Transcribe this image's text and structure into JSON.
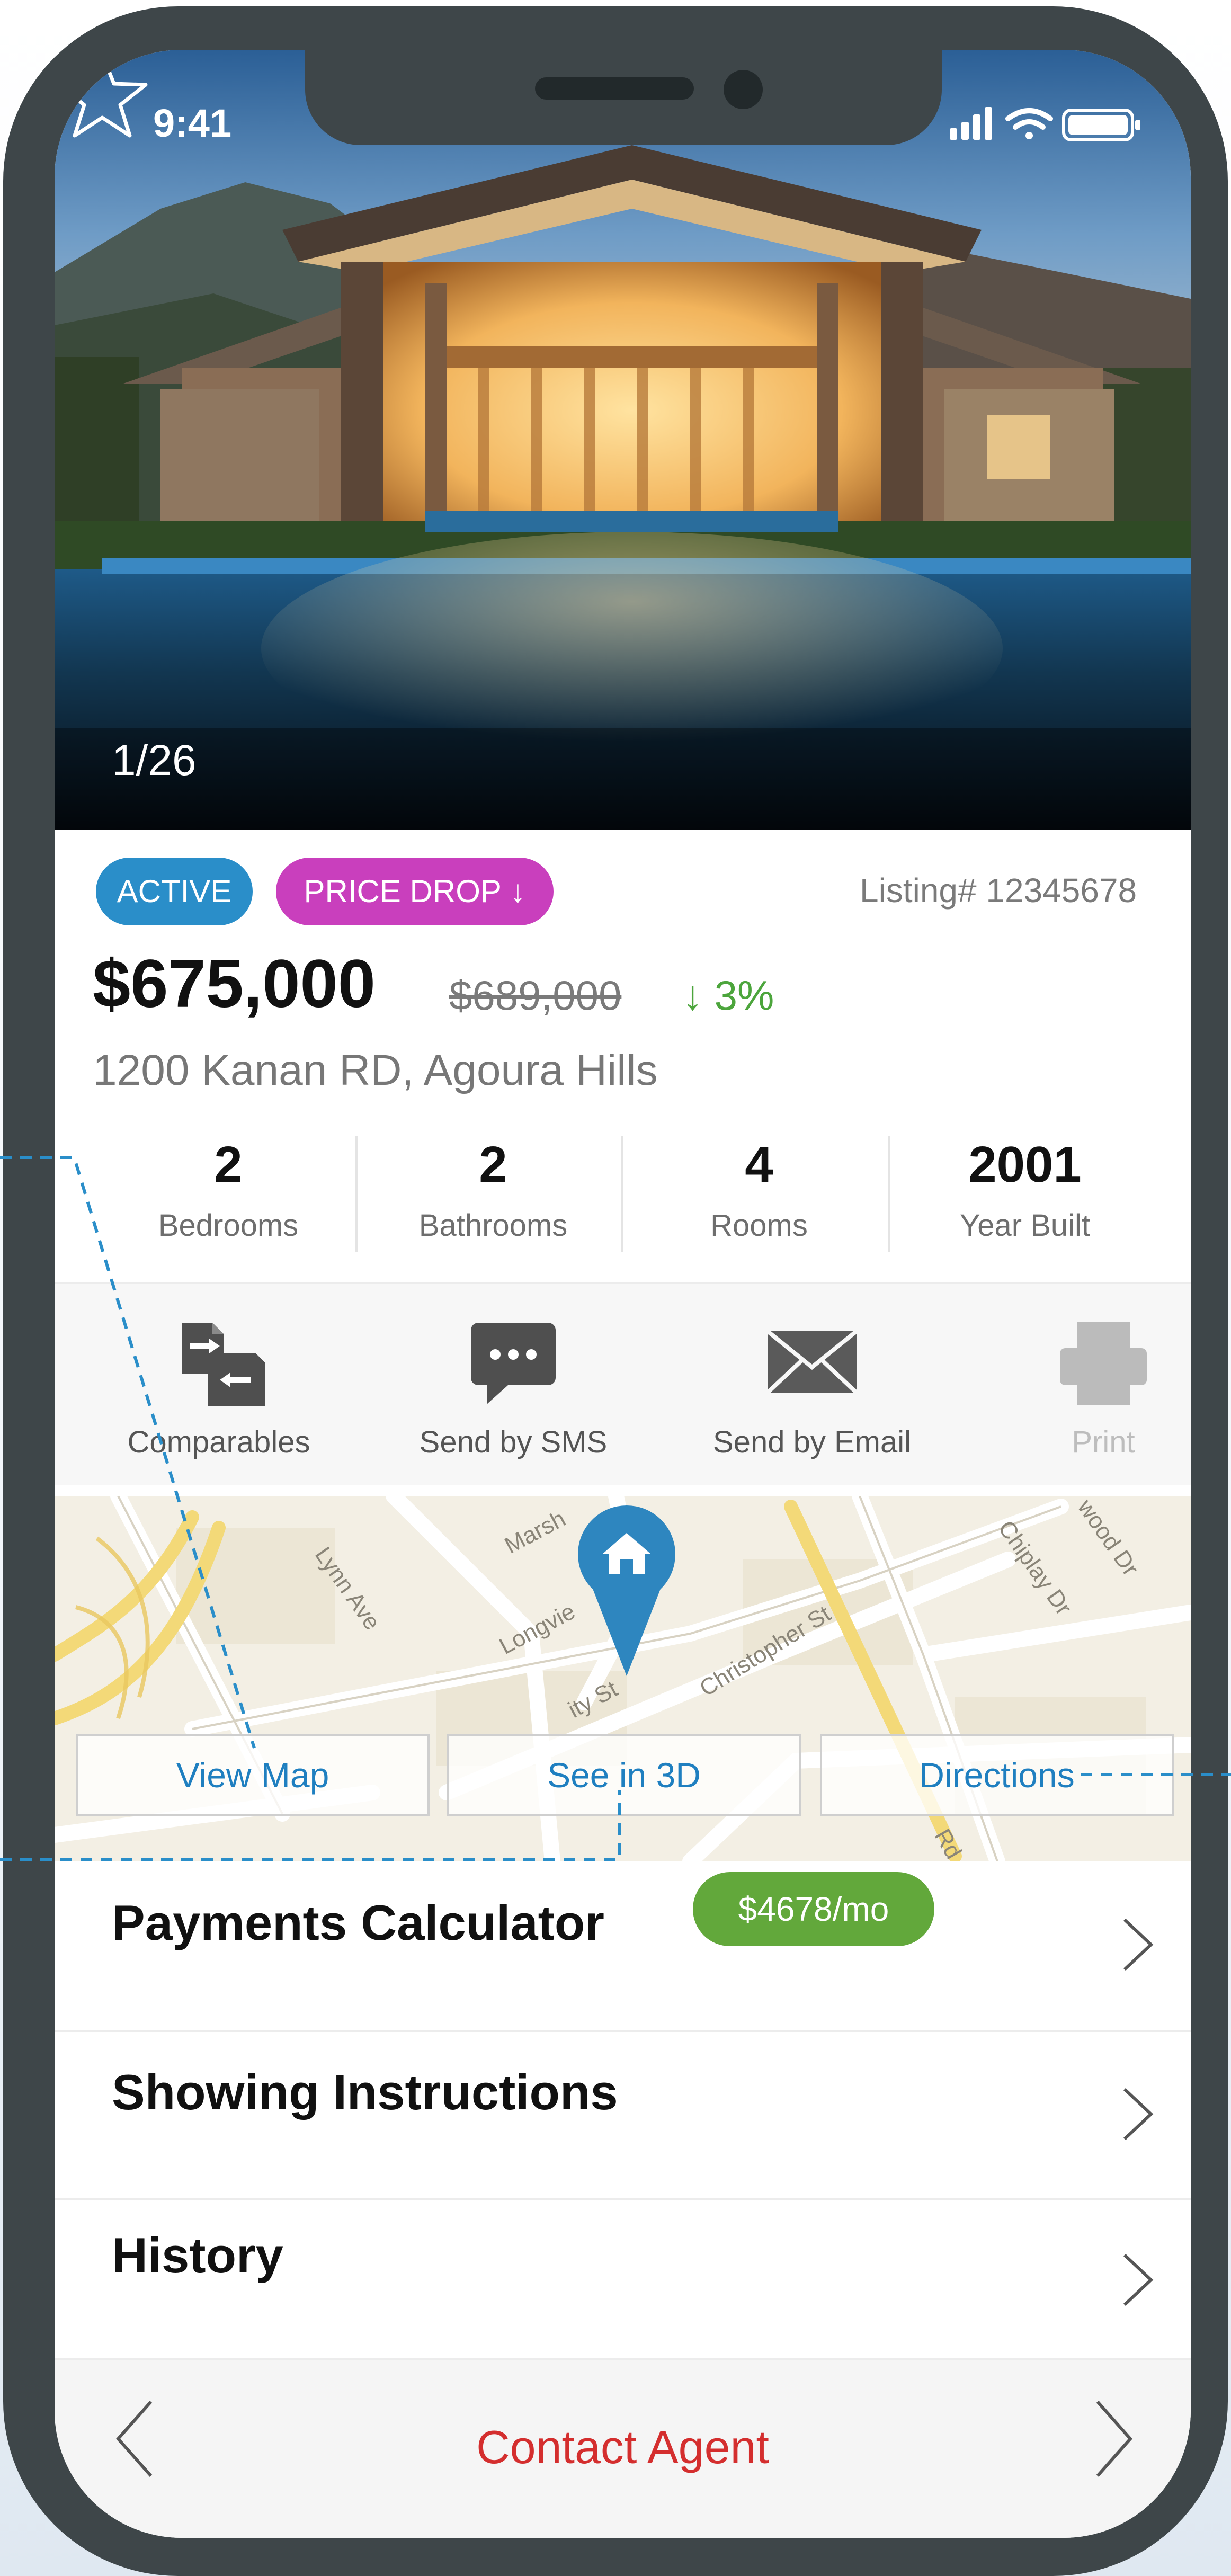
{
  "status_bar": {
    "time": "9:41"
  },
  "gallery": {
    "counter": "1/26"
  },
  "badges": {
    "active": "ACTIVE",
    "price_drop": "PRICE DROP ↓"
  },
  "listing_number": "Listing# 12345678",
  "price": {
    "current": "$675,000",
    "previous": "$689,000",
    "change": "↓ 3%"
  },
  "address": "1200 Kanan RD, Agoura Hills",
  "stats": [
    {
      "value": "2",
      "label": "Bedrooms"
    },
    {
      "value": "2",
      "label": "Bathrooms"
    },
    {
      "value": "4",
      "label": "Rooms"
    },
    {
      "value": "2001",
      "label": "Year Built"
    }
  ],
  "actions": [
    {
      "label": "Comparables",
      "icon": "compare-icon"
    },
    {
      "label": "Send by SMS",
      "icon": "sms-icon"
    },
    {
      "label": "Send by Email",
      "icon": "email-icon"
    },
    {
      "label": "Print",
      "icon": "print-icon"
    }
  ],
  "map": {
    "streets": [
      "Marsh",
      "Lynn Ave",
      "Longvie",
      "Christopher St",
      "Chiplay Dr",
      "wood Dr",
      "ity St",
      "Rd"
    ],
    "buttons": {
      "view_map": "View Map",
      "see_3d": "See in 3D",
      "directions": "Directions"
    }
  },
  "rows": {
    "payments": "Payments Calculator",
    "payments_pill": "$4678/mo",
    "showing": "Showing Instructions",
    "history": "History"
  },
  "bottom": {
    "contact": "Contact Agent"
  },
  "colors": {
    "frame": "#3e4649",
    "active_badge": "#2a8ec9",
    "price_drop_badge": "#c93fbd",
    "payment_pill": "#62a83b",
    "contact_text": "#d42e2e",
    "link_blue": "#1f7fc0"
  }
}
